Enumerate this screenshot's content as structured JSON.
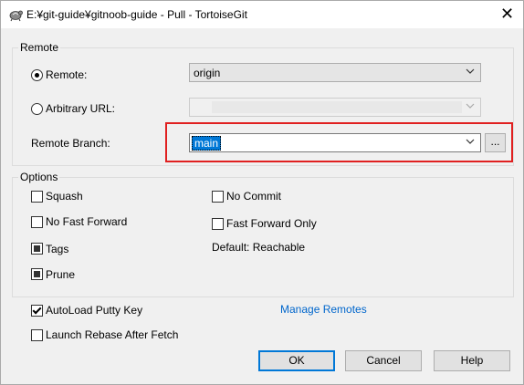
{
  "window": {
    "title": "E:¥git-guide¥gitnoob-guide - Pull - TortoiseGit",
    "close_glyph": "✕"
  },
  "remote_group": {
    "label": "Remote",
    "remote_label": "Remote:",
    "remote_selected": true,
    "remote_value": "origin",
    "arbitrary_url_label": "Arbitrary URL:",
    "arbitrary_url_selected": false,
    "arbitrary_url_value": "",
    "remote_branch_label": "Remote Branch:",
    "remote_branch_value": "main",
    "browse_button_label": "...",
    "highlight_color": "#e02020"
  },
  "options_group": {
    "label": "Options",
    "squash_label": "Squash",
    "squash_checked": false,
    "no_commit_label": "No Commit",
    "no_commit_checked": false,
    "no_fast_forward_label": "No Fast Forward",
    "no_fast_forward_checked": false,
    "fast_forward_only_label": "Fast Forward Only",
    "fast_forward_only_checked": false,
    "tags_label": "Tags",
    "tags_state": "indeterminate",
    "default_text": "Default: Reachable",
    "prune_label": "Prune",
    "prune_state": "indeterminate"
  },
  "bottom": {
    "autoload_putty_label": "AutoLoad Putty Key",
    "autoload_putty_checked": true,
    "launch_rebase_label": "Launch Rebase After Fetch",
    "launch_rebase_checked": false,
    "manage_remotes_link": "Manage Remotes",
    "ok_label": "OK",
    "cancel_label": "Cancel",
    "help_label": "Help"
  },
  "icons": {
    "app": "tortoisegit-icon",
    "dropdown": "chevron-down-icon",
    "close": "close-icon"
  },
  "colors": {
    "link": "#0066cc",
    "accent": "#0078d7",
    "highlight": "#e02020"
  }
}
